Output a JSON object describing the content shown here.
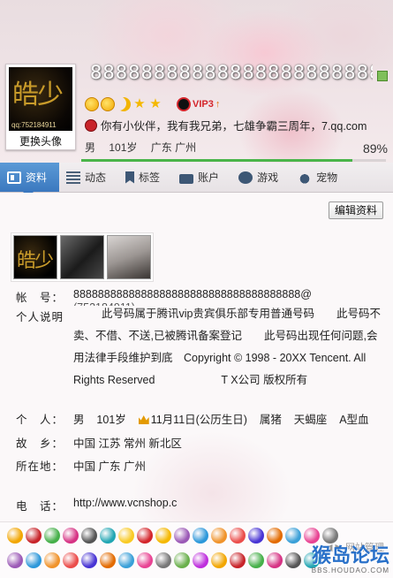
{
  "header": {
    "nickname": "888888888888888888888888",
    "avatar_change_label": "更换头像",
    "avatar_qq": "qq:752184911",
    "avatar_text": "皓少",
    "vip_label": "VIP3",
    "vip_up_icon": "arrow-up-icon",
    "signature": "你有小伙伴，我有我兄弟，七雄争霸三周年，7.qq.com",
    "gender": "男",
    "age": "101岁",
    "location": "广东 广州",
    "completion_percent": "89%",
    "completion_value": 0.89
  },
  "tabs": [
    {
      "label": "资料",
      "icon": "profile-card-icon"
    },
    {
      "label": "动态",
      "icon": "feed-list-icon"
    },
    {
      "label": "标签",
      "icon": "bookmark-icon"
    },
    {
      "label": "账户",
      "icon": "briefcase-icon"
    },
    {
      "label": "游戏",
      "icon": "game-icon"
    },
    {
      "label": "宠物",
      "icon": "pet-icon"
    }
  ],
  "content": {
    "edit_button": "编辑资料",
    "account_label": "帐　号：",
    "account_value": "8888888888888888888888888888888888888@",
    "account_sub": "(752184911)",
    "desc_label": "个人说明",
    "desc_value": "此号码属于腾讯vip贵宾俱乐部专用普通号码　　此号码不卖、不借、不送,已被腾讯备案登记　　此号码出现任何问题,会用法律手段维护到底　Copyright © 1998 - 20XX Tencent. All Rights Reserved　　　　　　T X公司 版权所有",
    "personal_label": "个　人：",
    "personal_gender": "男",
    "personal_age": "101岁",
    "personal_birthday": "11月11日(公历生日)",
    "personal_zodiac": "属猪",
    "personal_star": "天蝎座",
    "personal_blood": "A型血",
    "hometown_label": "故　乡：",
    "hometown_value": "中国 江苏 常州 新北区",
    "residence_label": "所在地：",
    "residence_value": "中国 广东 广州",
    "phone_label": "电　话：",
    "phone_value": "http://www.vcnshop.c"
  },
  "emoji_bar": {
    "tab_label": "◀ ▶ 网站管理",
    "watermark_big": "猴岛论坛",
    "watermark_small": "BBS.HOUDAO.COM"
  },
  "colors": {
    "tab_active": "#3b78bf",
    "progress": "#4ab54a",
    "vip_red": "#d4252b"
  }
}
